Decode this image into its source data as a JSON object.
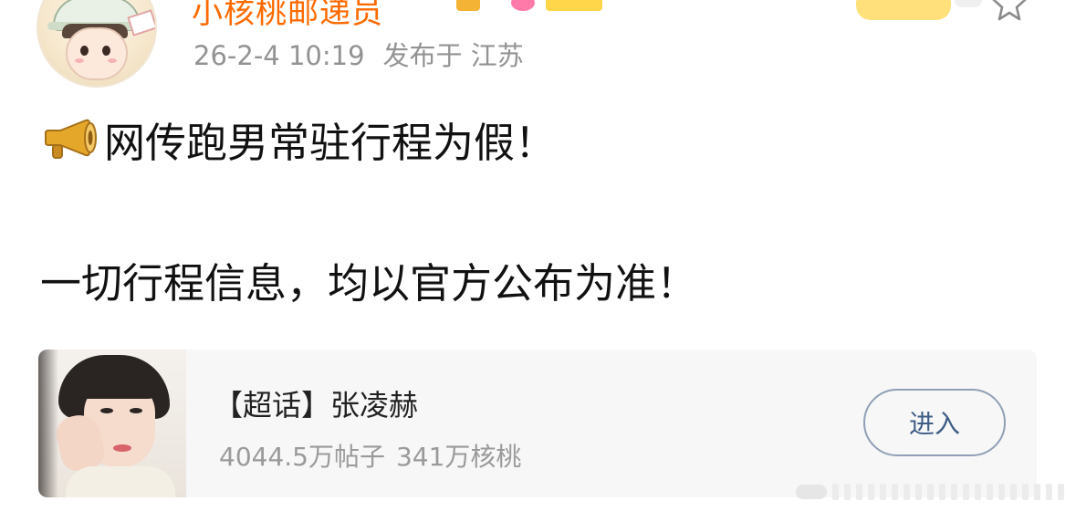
{
  "header": {
    "username": "小核桃邮递员",
    "post_time": "26-2-4 10:19",
    "location": "发布于 江苏",
    "username_color": "#ff6a00"
  },
  "post": {
    "icon": "megaphone-icon",
    "line1": "网传跑男常驻行程为假！",
    "line2": "一切行程信息，均以官方公布为准！"
  },
  "card": {
    "title": "【超话】张凌赫",
    "posts_count": "4044.5万帖子",
    "walnut_count": "341万核桃",
    "enter_label": "进入",
    "accent_color": "#3e5d86"
  }
}
